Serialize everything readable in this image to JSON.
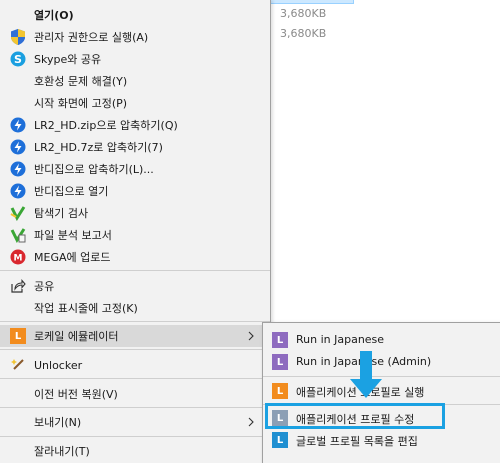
{
  "background": {
    "file_sizes": [
      "3,680KB",
      "3,680KB"
    ]
  },
  "menu": {
    "items": [
      {
        "label": "열기(O)",
        "icon": "none",
        "bold": true
      },
      {
        "label": "관리자 권한으로 실행(A)",
        "icon": "uac-shield-icon"
      },
      {
        "label": "Skype와 공유",
        "icon": "skype-icon"
      },
      {
        "label": "호환성 문제 해결(Y)",
        "icon": "none"
      },
      {
        "label": "시작 화면에 고정(P)",
        "icon": "none"
      },
      {
        "label": "LR2_HD.zip으로 압축하기(Q)",
        "icon": "bandizip-icon"
      },
      {
        "label": "LR2_HD.7z로 압축하기(7)",
        "icon": "bandizip-icon"
      },
      {
        "label": "반디집으로 압축하기(L)...",
        "icon": "bandizip-icon"
      },
      {
        "label": "반디집으로 열기",
        "icon": "bandizip-icon"
      },
      {
        "label": "탐색기 검사",
        "icon": "scan-icon"
      },
      {
        "label": "파일 분석 보고서",
        "icon": "report-icon"
      },
      {
        "label": "MEGA에 업로드",
        "icon": "mega-icon"
      },
      {
        "label": "공유",
        "icon": "share-icon"
      },
      {
        "label": "작업 표시줄에 고정(K)",
        "icon": "none"
      },
      {
        "label": "로케일 에뮬레이터",
        "icon": "locale-emulator-icon",
        "submenu": true
      },
      {
        "label": "Unlocker",
        "icon": "unlocker-wand-icon"
      },
      {
        "label": "이전 버전 복원(V)",
        "icon": "none"
      },
      {
        "label": "보내기(N)",
        "icon": "none",
        "submenu": true
      },
      {
        "label": "잘라내기(T)",
        "icon": "none"
      }
    ]
  },
  "submenu": {
    "items": [
      {
        "label": "Run in Japanese",
        "icon": "locale-purple-icon"
      },
      {
        "label": "Run in Japanese (Admin)",
        "icon": "locale-purple-icon"
      },
      {
        "label": "애플리케이션 프로필로 실행",
        "icon": "locale-orange-icon"
      },
      {
        "label": "애플리케이션 프로필 수정",
        "icon": "locale-gray-icon"
      },
      {
        "label": "글로벌 프로필 목록을 편집",
        "icon": "locale-blue-icon"
      }
    ]
  },
  "colors": {
    "highlight": "#1ba1e2",
    "bandizip": "#1e6fd9",
    "locale_orange": "#f28c1e",
    "locale_purple": "#8e6bbf",
    "mega_red": "#d9272e"
  }
}
